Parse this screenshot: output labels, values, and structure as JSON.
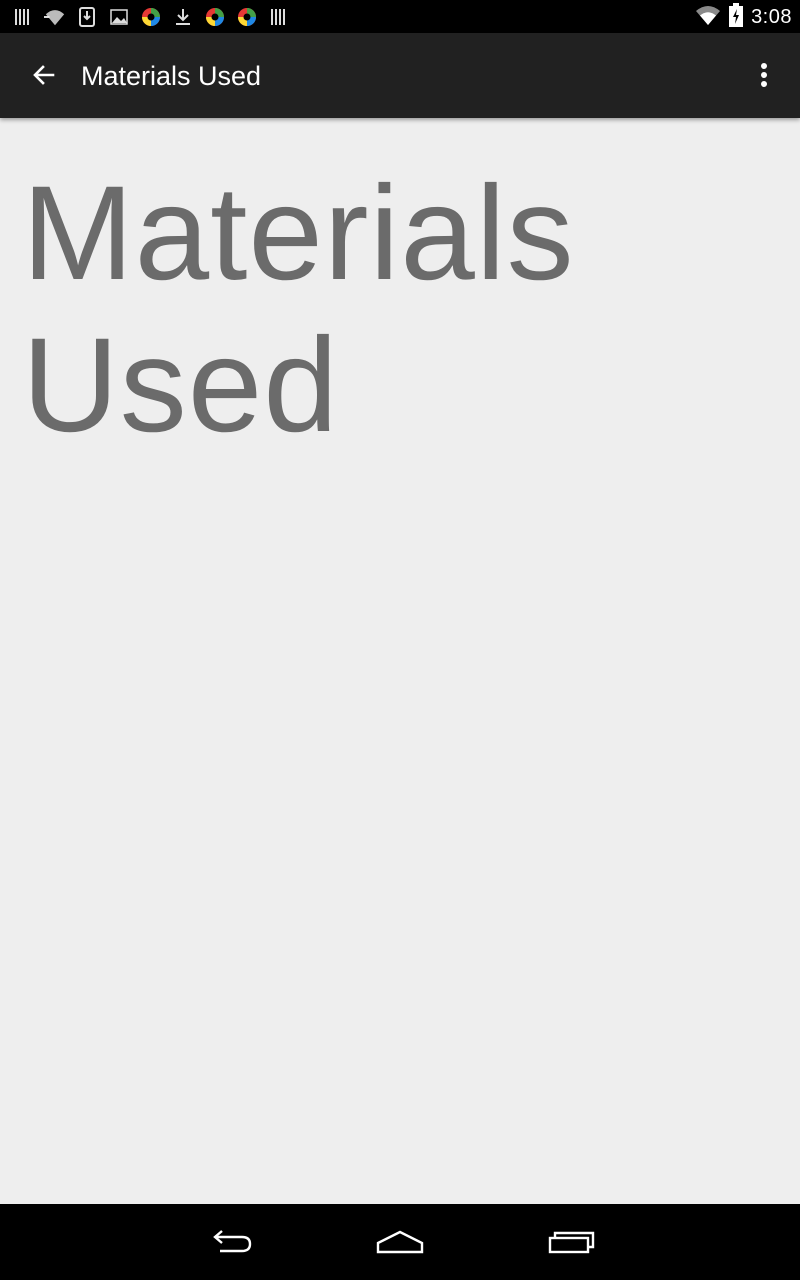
{
  "status_bar": {
    "time": "3:08",
    "notification_icons": [
      "barcode-icon",
      "wifi-signal-icon",
      "download-box-icon",
      "image-icon",
      "color-wheel-icon",
      "download-icon",
      "color-wheel-icon",
      "color-wheel-icon",
      "barcode-icon"
    ],
    "system_icons": [
      "wifi-icon",
      "battery-charging-icon"
    ]
  },
  "app_bar": {
    "title": "Materials Used",
    "back_icon": "arrow-back-icon",
    "overflow_icon": "more-vert-icon"
  },
  "content": {
    "heading": "Materials Used"
  },
  "nav_bar": {
    "icons": [
      "nav-back-icon",
      "nav-home-icon",
      "nav-recents-icon"
    ]
  },
  "colors": {
    "status_bar": "#000000",
    "app_bar": "#212121",
    "background": "#eeeeee",
    "heading_text": "#6b6b6b",
    "nav_bar": "#000000"
  }
}
